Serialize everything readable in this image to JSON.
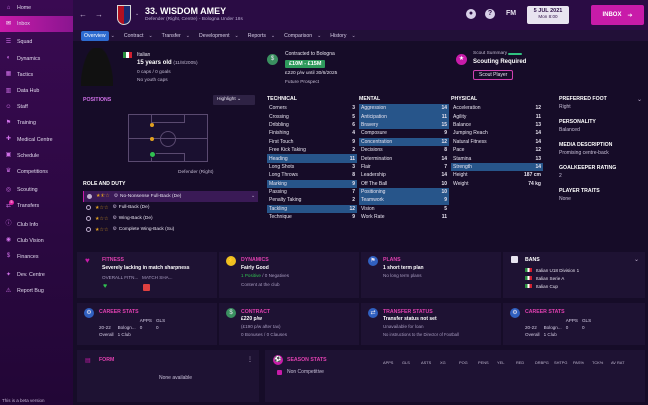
{
  "sidebar": {
    "items": [
      {
        "label": "Home",
        "icon": "home-icon"
      },
      {
        "label": "Inbox",
        "icon": "inbox-icon",
        "active": true
      },
      {
        "label": "Squad",
        "icon": "squad-icon"
      },
      {
        "label": "Dynamics",
        "icon": "dynamics-icon"
      },
      {
        "label": "Tactics",
        "icon": "tactics-icon"
      },
      {
        "label": "Data Hub",
        "icon": "data-hub-icon"
      },
      {
        "label": "Staff",
        "icon": "staff-icon"
      },
      {
        "label": "Training",
        "icon": "training-icon"
      },
      {
        "label": "Medical Centre",
        "icon": "medical-icon"
      },
      {
        "label": "Schedule",
        "icon": "schedule-icon"
      },
      {
        "label": "Competitions",
        "icon": "competitions-icon"
      },
      {
        "label": "Scouting",
        "icon": "scouting-icon"
      },
      {
        "label": "Transfers",
        "icon": "transfers-icon",
        "badge": "5"
      },
      {
        "label": "Club Info",
        "icon": "club-info-icon"
      },
      {
        "label": "Club Vision",
        "icon": "club-vision-icon"
      },
      {
        "label": "Finances",
        "icon": "finances-icon"
      },
      {
        "label": "Dev. Centre",
        "icon": "dev-centre-icon"
      },
      {
        "label": "Report Bug",
        "icon": "report-bug-icon"
      }
    ],
    "beta": "This is a beta version"
  },
  "header": {
    "player_name": "33. WISDOM AMEY",
    "player_sub": "Defender (Right, Centre) - Bologna Under 18s",
    "date": "5 JUL 2021",
    "day": "Mon 8:00",
    "inbox_label": "INBOX",
    "fm": "FM"
  },
  "tabs": [
    "Overview",
    "Contract",
    "Transfer",
    "Development",
    "Reports",
    "Comparison",
    "History"
  ],
  "bio": {
    "nation": "Italian",
    "age": "15 years old",
    "dob": "(11/8/2005)",
    "caps": "0 caps / 0 goals",
    "youth": "No youth caps"
  },
  "contract_card": {
    "title": "Contracted to Bologna",
    "value": "£10M - £15M",
    "wage": "£220 p/w",
    "until": "until 30/6/2025",
    "prospect": "Future Prospect"
  },
  "scout": {
    "title": "Scout Summary",
    "status": "Scouting Required",
    "button": "Scout Player"
  },
  "positions": {
    "title": "POSITIONS",
    "highlight": "Highlight",
    "role_label": "Defender (Right)"
  },
  "role_duty": {
    "title": "ROLE AND DUTY",
    "items": [
      {
        "stars": "1.5",
        "name": "No-Nonsense Full-Back (De)",
        "active": true
      },
      {
        "stars": "1",
        "name": "Full-Back (De)"
      },
      {
        "stars": "1",
        "name": "Wing-Back (De)"
      },
      {
        "stars": "1",
        "name": "Complete Wing-Back (Su)"
      }
    ]
  },
  "technical": {
    "title": "TECHNICAL",
    "attrs": [
      [
        "Corners",
        "3"
      ],
      [
        "Crossing",
        "5"
      ],
      [
        "Dribbling",
        "6"
      ],
      [
        "Finishing",
        "4"
      ],
      [
        "First Touch",
        "9"
      ],
      [
        "Free Kick Taking",
        "2"
      ],
      [
        "Heading",
        "11"
      ],
      [
        "Long Shots",
        "3"
      ],
      [
        "Long Throws",
        "8"
      ],
      [
        "Marking",
        "9"
      ],
      [
        "Passing",
        "7"
      ],
      [
        "Penalty Taking",
        "2"
      ],
      [
        "Tackling",
        "12"
      ],
      [
        "Technique",
        "9"
      ]
    ]
  },
  "mental": {
    "title": "MENTAL",
    "attrs": [
      [
        "Aggression",
        "14"
      ],
      [
        "Anticipation",
        "11"
      ],
      [
        "Bravery",
        "15"
      ],
      [
        "Composure",
        "9"
      ],
      [
        "Concentration",
        "12"
      ],
      [
        "Decisions",
        "8"
      ],
      [
        "Determination",
        "14"
      ],
      [
        "Flair",
        "7"
      ],
      [
        "Leadership",
        "14"
      ],
      [
        "Off The Ball",
        "10"
      ],
      [
        "Positioning",
        "10"
      ],
      [
        "Teamwork",
        "9"
      ],
      [
        "Vision",
        "5"
      ],
      [
        "Work Rate",
        "11"
      ]
    ]
  },
  "physical": {
    "title": "PHYSICAL",
    "attrs": [
      [
        "Acceleration",
        "12"
      ],
      [
        "Agility",
        "11"
      ],
      [
        "Balance",
        "13"
      ],
      [
        "Jumping Reach",
        "14"
      ],
      [
        "Natural Fitness",
        "14"
      ],
      [
        "Pace",
        "12"
      ],
      [
        "Stamina",
        "13"
      ],
      [
        "Strength",
        "14"
      ]
    ],
    "height_label": "Height",
    "height": "187 cm",
    "weight_label": "Weight",
    "weight": "74 kg"
  },
  "info": {
    "pref_foot_label": "PREFERRED FOOT",
    "pref_foot": "Right",
    "personality_label": "PERSONALITY",
    "personality": "Balanced",
    "media_label": "MEDIA DESCRIPTION",
    "media": "Promising centre-back",
    "gk_label": "GOALKEEPER RATING",
    "gk": "2",
    "traits_label": "PLAYER TRAITS",
    "traits": "None"
  },
  "fitness": {
    "title": "FITNESS",
    "text": "Severely lacking in match sharpness",
    "c1": "OVERALL FITN...",
    "c2": "MATCH SHA..."
  },
  "dynamics": {
    "title": "DYNAMICS",
    "text": "Fairly Good",
    "pos": "1 Positive",
    "neg": "0 Negatives",
    "note": "Content at the club"
  },
  "plans": {
    "title": "PLANS",
    "text": "1 short term plan",
    "note": "No long term plans"
  },
  "bans": {
    "title": "BANS",
    "rows": [
      "Italian U18 Division 1",
      "Italian Serie A",
      "Italian Cup"
    ]
  },
  "career1": {
    "title": "CAREER STATS",
    "h": [
      "APPS",
      "GLS"
    ],
    "season": "20-22",
    "club": "Bologn...",
    "apps": "0",
    "gls": "0",
    "overall": "Overall",
    "clubs": "1 Club"
  },
  "contract2": {
    "title": "CONTRACT",
    "wage": "£220 p/w",
    "per": "(£190 p/w after tax)",
    "bonuses": "0 Bonuses",
    "clauses": "0 Clauses"
  },
  "transfer": {
    "title": "TRANSFER STATUS",
    "text": "Transfer status not set",
    "l1": "Unavailable for loan",
    "l2": "No instructions to the Director of Football"
  },
  "career2": {
    "title": "CAREER STATS",
    "h": [
      "APPS",
      "GLS"
    ],
    "season": "20-22",
    "club": "Bologn...",
    "apps": "0",
    "gls": "0",
    "overall": "Overall",
    "clubs": "1 Club"
  },
  "form": {
    "title": "FORM",
    "text": "None available"
  },
  "season": {
    "title": "SEASON STATS",
    "cols": [
      "APPS",
      "GLS",
      "ASTS",
      "XG",
      "POG",
      "PENS",
      "YEL",
      "RED",
      "DRBPG",
      "SHTPG",
      "PAS%",
      "TCK%",
      "AV RAT"
    ],
    "row": "Non Competitive"
  }
}
